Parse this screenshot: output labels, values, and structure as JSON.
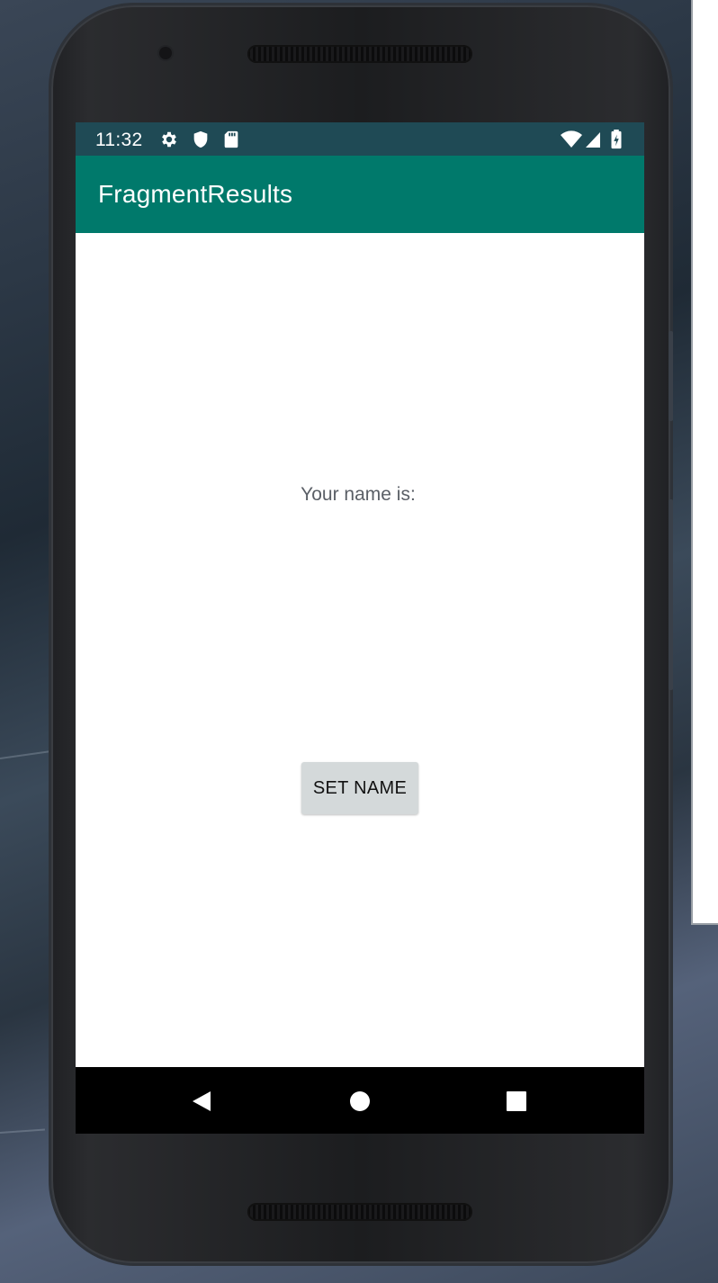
{
  "status_bar": {
    "time": "11:32",
    "left_icons": [
      "gear-icon",
      "shield-icon",
      "sd-card-icon"
    ],
    "right_icons": [
      "wifi-icon",
      "signal-icon",
      "battery-charging-icon"
    ]
  },
  "app_bar": {
    "title": "FragmentResults",
    "color": "#00796b"
  },
  "main": {
    "name_label": "Your name is:",
    "set_name_button": "SET NAME"
  },
  "nav_bar": {
    "buttons": [
      "back-icon",
      "home-icon",
      "recents-icon"
    ]
  },
  "colors": {
    "status_bar": "#1f4a55",
    "app_bar": "#00796b",
    "button_bg": "#d4d9da"
  }
}
